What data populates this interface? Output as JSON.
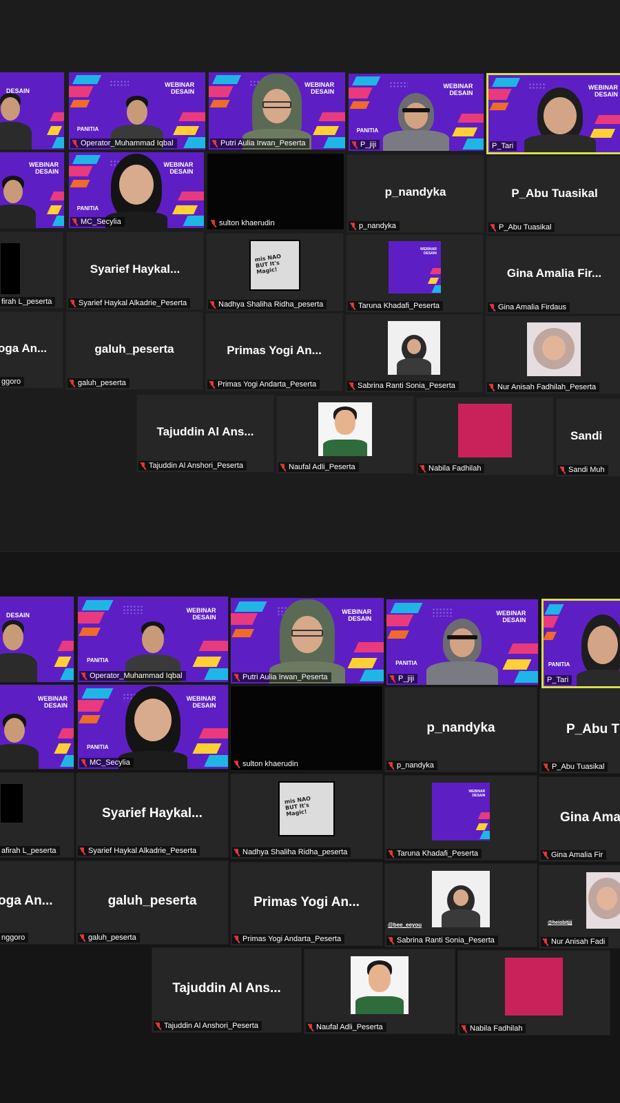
{
  "banner": {
    "title": "WEBINAR\nDESAIN",
    "panitia": "PANITIA",
    "cut_title": "DESAIN"
  },
  "participants": {
    "operator": {
      "name": "Operator_Muhammad Iqbal"
    },
    "putri": {
      "name": "Putri Aulia Irwan_Peserta"
    },
    "jiji": {
      "name": "P_jiji"
    },
    "tari": {
      "name": "P_Tari"
    },
    "secylia": {
      "name": "MC_Secylia"
    },
    "sulton": {
      "name": "sulton khaerudin"
    },
    "nandyka": {
      "display": "p_nandyka",
      "name": "p_nandyka"
    },
    "abu": {
      "display": "P_Abu Tuasikal",
      "name": "P_Abu Tuasikal",
      "display_cut": "P_Abu T"
    },
    "syarief": {
      "display": "Syarief Haykal...",
      "name": "Syarief Haykal Alkadrie_Peserta"
    },
    "nadhya": {
      "name": "Nadhya Shaliha Ridha_peserta",
      "sketch_text": "mis NAO\nBUT It's\nMagic!"
    },
    "taruna": {
      "name": "Taruna Khadafi_Peserta"
    },
    "gina": {
      "display": "Gina Amalia Fir...",
      "name": "Gina Amalia Firdaus",
      "display_cut": "Gina Ama",
      "name_cut": "Gina Amalia Fir"
    },
    "galuh": {
      "display": "galuh_peserta",
      "name": "galuh_peserta"
    },
    "primas": {
      "display": "Primas Yogi An...",
      "name": "Primas Yogi Andarta_Peserta"
    },
    "sabrina": {
      "name": "Sabrina Ranti Sonia_Peserta",
      "handle": "@bee_eeyou"
    },
    "nur": {
      "name": "Nur Anisah Fadhilah_Peserta",
      "name_cut": "Nur Anisah Fadi",
      "handle": "@heiobitjjj"
    },
    "tajuddin": {
      "display": "Tajuddin Al Ans...",
      "name": "Tajuddin Al Anshori_Peserta"
    },
    "naufal": {
      "name": "Naufal Adli_Peserta"
    },
    "nabila": {
      "name": "Nabila Fadhilah"
    },
    "sandi": {
      "display": "Sandi",
      "name": "Sandi Muh"
    },
    "firah": {
      "name": "firah L_peserta",
      "name_b": "afirah L_peserta"
    },
    "yoga": {
      "display": "oga An...",
      "name": "ggoro",
      "name_b": "nggoro"
    }
  },
  "colors": {
    "banner_purple": "#5d1fc4",
    "speaking_border": "#d9e04a",
    "muted_mic": "#e53935",
    "nabila_tile": "#c9225a"
  }
}
